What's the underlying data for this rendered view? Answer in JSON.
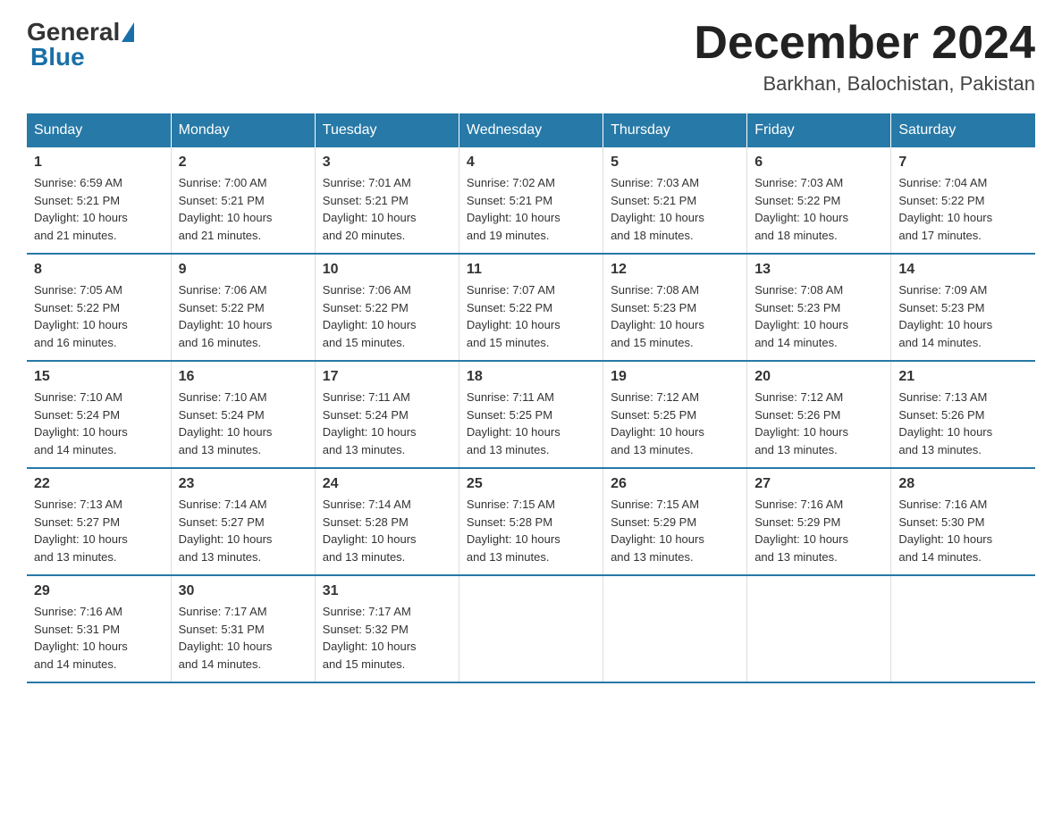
{
  "header": {
    "logo_general": "General",
    "logo_blue": "Blue",
    "month_title": "December 2024",
    "subtitle": "Barkhan, Balochistan, Pakistan"
  },
  "weekdays": [
    "Sunday",
    "Monday",
    "Tuesday",
    "Wednesday",
    "Thursday",
    "Friday",
    "Saturday"
  ],
  "weeks": [
    [
      {
        "day": "1",
        "info": "Sunrise: 6:59 AM\nSunset: 5:21 PM\nDaylight: 10 hours\nand 21 minutes."
      },
      {
        "day": "2",
        "info": "Sunrise: 7:00 AM\nSunset: 5:21 PM\nDaylight: 10 hours\nand 21 minutes."
      },
      {
        "day": "3",
        "info": "Sunrise: 7:01 AM\nSunset: 5:21 PM\nDaylight: 10 hours\nand 20 minutes."
      },
      {
        "day": "4",
        "info": "Sunrise: 7:02 AM\nSunset: 5:21 PM\nDaylight: 10 hours\nand 19 minutes."
      },
      {
        "day": "5",
        "info": "Sunrise: 7:03 AM\nSunset: 5:21 PM\nDaylight: 10 hours\nand 18 minutes."
      },
      {
        "day": "6",
        "info": "Sunrise: 7:03 AM\nSunset: 5:22 PM\nDaylight: 10 hours\nand 18 minutes."
      },
      {
        "day": "7",
        "info": "Sunrise: 7:04 AM\nSunset: 5:22 PM\nDaylight: 10 hours\nand 17 minutes."
      }
    ],
    [
      {
        "day": "8",
        "info": "Sunrise: 7:05 AM\nSunset: 5:22 PM\nDaylight: 10 hours\nand 16 minutes."
      },
      {
        "day": "9",
        "info": "Sunrise: 7:06 AM\nSunset: 5:22 PM\nDaylight: 10 hours\nand 16 minutes."
      },
      {
        "day": "10",
        "info": "Sunrise: 7:06 AM\nSunset: 5:22 PM\nDaylight: 10 hours\nand 15 minutes."
      },
      {
        "day": "11",
        "info": "Sunrise: 7:07 AM\nSunset: 5:22 PM\nDaylight: 10 hours\nand 15 minutes."
      },
      {
        "day": "12",
        "info": "Sunrise: 7:08 AM\nSunset: 5:23 PM\nDaylight: 10 hours\nand 15 minutes."
      },
      {
        "day": "13",
        "info": "Sunrise: 7:08 AM\nSunset: 5:23 PM\nDaylight: 10 hours\nand 14 minutes."
      },
      {
        "day": "14",
        "info": "Sunrise: 7:09 AM\nSunset: 5:23 PM\nDaylight: 10 hours\nand 14 minutes."
      }
    ],
    [
      {
        "day": "15",
        "info": "Sunrise: 7:10 AM\nSunset: 5:24 PM\nDaylight: 10 hours\nand 14 minutes."
      },
      {
        "day": "16",
        "info": "Sunrise: 7:10 AM\nSunset: 5:24 PM\nDaylight: 10 hours\nand 13 minutes."
      },
      {
        "day": "17",
        "info": "Sunrise: 7:11 AM\nSunset: 5:24 PM\nDaylight: 10 hours\nand 13 minutes."
      },
      {
        "day": "18",
        "info": "Sunrise: 7:11 AM\nSunset: 5:25 PM\nDaylight: 10 hours\nand 13 minutes."
      },
      {
        "day": "19",
        "info": "Sunrise: 7:12 AM\nSunset: 5:25 PM\nDaylight: 10 hours\nand 13 minutes."
      },
      {
        "day": "20",
        "info": "Sunrise: 7:12 AM\nSunset: 5:26 PM\nDaylight: 10 hours\nand 13 minutes."
      },
      {
        "day": "21",
        "info": "Sunrise: 7:13 AM\nSunset: 5:26 PM\nDaylight: 10 hours\nand 13 minutes."
      }
    ],
    [
      {
        "day": "22",
        "info": "Sunrise: 7:13 AM\nSunset: 5:27 PM\nDaylight: 10 hours\nand 13 minutes."
      },
      {
        "day": "23",
        "info": "Sunrise: 7:14 AM\nSunset: 5:27 PM\nDaylight: 10 hours\nand 13 minutes."
      },
      {
        "day": "24",
        "info": "Sunrise: 7:14 AM\nSunset: 5:28 PM\nDaylight: 10 hours\nand 13 minutes."
      },
      {
        "day": "25",
        "info": "Sunrise: 7:15 AM\nSunset: 5:28 PM\nDaylight: 10 hours\nand 13 minutes."
      },
      {
        "day": "26",
        "info": "Sunrise: 7:15 AM\nSunset: 5:29 PM\nDaylight: 10 hours\nand 13 minutes."
      },
      {
        "day": "27",
        "info": "Sunrise: 7:16 AM\nSunset: 5:29 PM\nDaylight: 10 hours\nand 13 minutes."
      },
      {
        "day": "28",
        "info": "Sunrise: 7:16 AM\nSunset: 5:30 PM\nDaylight: 10 hours\nand 14 minutes."
      }
    ],
    [
      {
        "day": "29",
        "info": "Sunrise: 7:16 AM\nSunset: 5:31 PM\nDaylight: 10 hours\nand 14 minutes."
      },
      {
        "day": "30",
        "info": "Sunrise: 7:17 AM\nSunset: 5:31 PM\nDaylight: 10 hours\nand 14 minutes."
      },
      {
        "day": "31",
        "info": "Sunrise: 7:17 AM\nSunset: 5:32 PM\nDaylight: 10 hours\nand 15 minutes."
      },
      {
        "day": "",
        "info": ""
      },
      {
        "day": "",
        "info": ""
      },
      {
        "day": "",
        "info": ""
      },
      {
        "day": "",
        "info": ""
      }
    ]
  ]
}
